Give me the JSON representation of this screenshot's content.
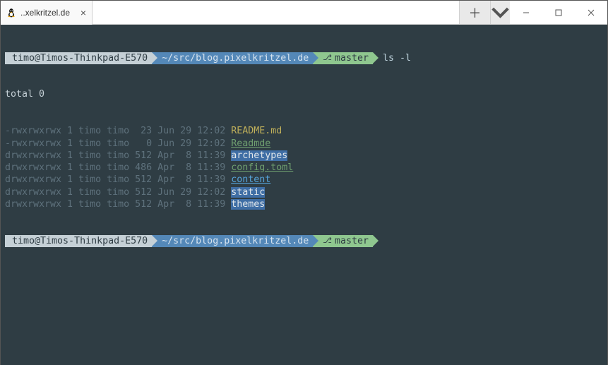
{
  "window": {
    "tab_title": "..xelkritzel.de"
  },
  "prompt1": {
    "user": "timo@Timos-Thinkpad-E570",
    "path": "~/src/blog.pixelkritzel.de",
    "branch_icon": "⎇",
    "branch": "master",
    "command": "ls -l"
  },
  "output": {
    "total": "total 0",
    "rows": [
      {
        "perm": "-rwxrwxrwx",
        "links": "1",
        "owner": "timo",
        "group": "timo",
        "size": " 23",
        "date": "Jun 29 12:02",
        "name": "README.md",
        "cls": "fname-exec"
      },
      {
        "perm": "-rwxrwxrwx",
        "links": "1",
        "owner": "timo",
        "group": "timo",
        "size": "  0",
        "date": "Jun 29 12:02",
        "name": "Readmde",
        "cls": "fname-file"
      },
      {
        "perm": "drwxrwxrwx",
        "links": "1",
        "owner": "timo",
        "group": "timo",
        "size": "512",
        "date": "Apr  8 11:39",
        "name": "archetypes",
        "cls": "fname-dir"
      },
      {
        "perm": "drwxrwxrwx",
        "links": "1",
        "owner": "timo",
        "group": "timo",
        "size": "486",
        "date": "Apr  8 11:39",
        "name": "config.toml",
        "cls": "fname-file"
      },
      {
        "perm": "drwxrwxrwx",
        "links": "1",
        "owner": "timo",
        "group": "timo",
        "size": "512",
        "date": "Apr  8 11:39",
        "name": "content",
        "cls": "fname-dir2"
      },
      {
        "perm": "drwxrwxrwx",
        "links": "1",
        "owner": "timo",
        "group": "timo",
        "size": "512",
        "date": "Jun 29 12:02",
        "name": "static",
        "cls": "fname-dir"
      },
      {
        "perm": "drwxrwxrwx",
        "links": "1",
        "owner": "timo",
        "group": "timo",
        "size": "512",
        "date": "Apr  8 11:39",
        "name": "themes",
        "cls": "fname-dir"
      }
    ]
  },
  "prompt2": {
    "user": "timo@Timos-Thinkpad-E570",
    "path": "~/src/blog.pixelkritzel.de",
    "branch_icon": "⎇",
    "branch": "master"
  }
}
